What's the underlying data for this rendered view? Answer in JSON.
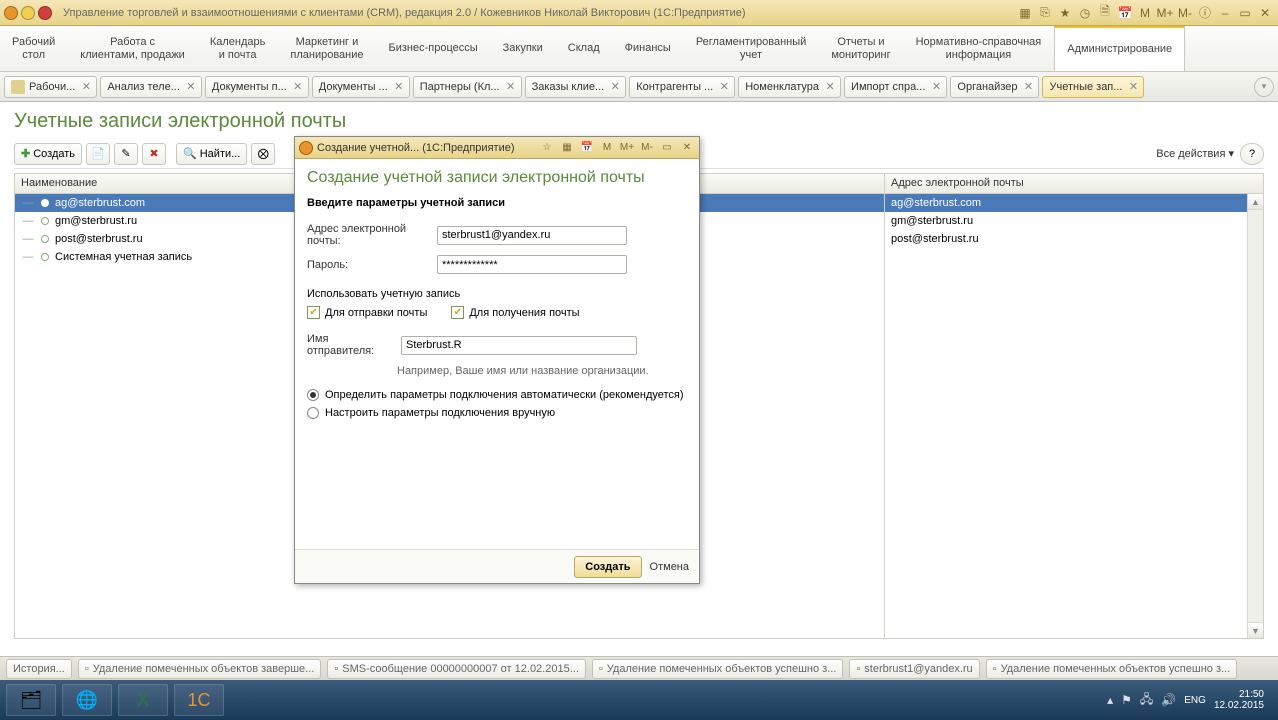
{
  "titlebar": {
    "title": "Управление торговлей и взаимоотношениями с клиентами (CRM), редакция 2.0 / Кожевников Николай Викторович  (1С:Предприятие)"
  },
  "sections": [
    {
      "l1": "Рабочий",
      "l2": "стол"
    },
    {
      "l1": "Работа с",
      "l2": "клиентами, продажи"
    },
    {
      "l1": "Календарь",
      "l2": "и почта"
    },
    {
      "l1": "Маркетинг и",
      "l2": "планирование"
    },
    {
      "l1": "Бизнес-процессы",
      "l2": ""
    },
    {
      "l1": "Закупки",
      "l2": ""
    },
    {
      "l1": "Склад",
      "l2": ""
    },
    {
      "l1": "Финансы",
      "l2": ""
    },
    {
      "l1": "Регламентированный",
      "l2": "учет"
    },
    {
      "l1": "Отчеты и",
      "l2": "мониторинг"
    },
    {
      "l1": "Нормативно-справочная",
      "l2": "информация"
    },
    {
      "l1": "Администрирование",
      "l2": ""
    }
  ],
  "tabs": [
    {
      "label": "Рабочи..."
    },
    {
      "label": "Анализ теле..."
    },
    {
      "label": "Документы п..."
    },
    {
      "label": "Документы ..."
    },
    {
      "label": "Партнеры (Кл..."
    },
    {
      "label": "Заказы клие..."
    },
    {
      "label": "Контрагенты ..."
    },
    {
      "label": "Номенклатура"
    },
    {
      "label": "Импорт спра..."
    },
    {
      "label": "Органайзер"
    },
    {
      "label": "Учетные зап..."
    }
  ],
  "page": {
    "title": "Учетные записи электронной почты",
    "create": "Создать",
    "find": "Найти...",
    "all_actions": "Все действия"
  },
  "columns": {
    "name": "Наименование",
    "email": "Адрес электронной почты"
  },
  "rows": [
    {
      "name": "ag@sterbrust.com",
      "email": "ag@sterbrust.com",
      "selected": true
    },
    {
      "name": "gm@sterbrust.ru",
      "email": "gm@sterbrust.ru"
    },
    {
      "name": "post@sterbrust.ru",
      "email": "post@sterbrust.ru"
    },
    {
      "name": "Системная учетная запись",
      "email": ""
    }
  ],
  "dialog": {
    "wintitle": "Создание учетной...  (1С:Предприятие)",
    "title": "Создание учетной записи электронной почты",
    "subtitle": "Введите параметры учетной записи",
    "email_label": "Адрес электронной почты:",
    "email_value": "sterbrust1@yandex.ru",
    "password_label": "Пароль:",
    "password_value": "*************",
    "use_label": "Использовать учетную запись",
    "cb_send": "Для отправки почты",
    "cb_recv": "Для получения почты",
    "sender_label": "Имя отправителя:",
    "sender_value": "Sterbrust.R",
    "hint": "Например, Ваше имя или название организации.",
    "radio_auto": "Определить параметры подключения автоматически (рекомендуется)",
    "radio_manual": "Настроить параметры подключения вручную",
    "btn_create": "Создать",
    "btn_cancel": "Отмена"
  },
  "history": {
    "btn": "История...",
    "items": [
      "Удаление помеченных объектов заверше...",
      "SMS-сообщение 00000000007 от 12.02.2015...",
      "Удаление помеченных объектов успешно з...",
      "sterbrust1@yandex.ru",
      "Удаление помеченных объектов успешно з..."
    ]
  },
  "tray": {
    "lang": "ENG",
    "time": "21:50",
    "date": "12.02.2015"
  }
}
